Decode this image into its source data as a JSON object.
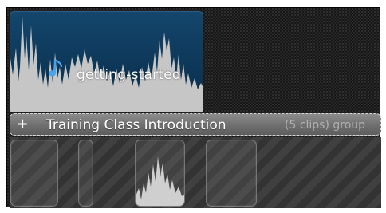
{
  "clip": {
    "title": "getting-started",
    "icon": "music-note-icon",
    "accent_color": "#0e3a5c"
  },
  "group": {
    "expand_symbol": "+",
    "title": "Training Class  Introduction",
    "clip_count_label": "(5 clips) group"
  },
  "colors": {
    "background": "#171717",
    "group_bar": "#757575",
    "waveform": "#c3c3c3"
  }
}
